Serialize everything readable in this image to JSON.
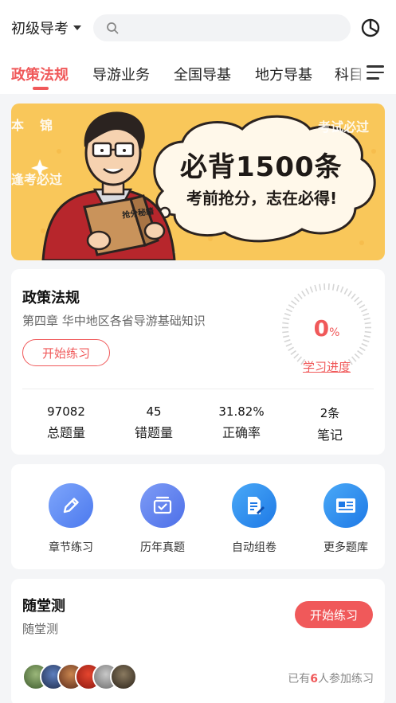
{
  "header": {
    "exam_selector": "初级导考",
    "search_placeholder": "",
    "stats_icon": "pie-chart-icon"
  },
  "tabs": [
    {
      "label": "政策法规",
      "active": true
    },
    {
      "label": "导游业务",
      "active": false
    },
    {
      "label": "全国导基",
      "active": false
    },
    {
      "label": "地方导基",
      "active": false
    },
    {
      "label": "科目",
      "active": false
    }
  ],
  "banner": {
    "headline": "必背1500条",
    "subline": "考前抢分，志在必得!",
    "book_label": "抢分秘籍",
    "bg_words": [
      "本",
      "锦",
      "逢考必过",
      "考试必过"
    ]
  },
  "policy_card": {
    "title": "政策法规",
    "chapter": "第四章  华中地区各省导游基础知识",
    "start_button": "开始练习",
    "progress": {
      "value": "0",
      "unit": "%",
      "fraction": 0,
      "link": "学习进度"
    },
    "stats": [
      {
        "value": "97082",
        "label": "总题量"
      },
      {
        "value": "45",
        "label": "错题量"
      },
      {
        "value": "31.82%",
        "label": "正确率"
      },
      {
        "value": "2条",
        "label": "笔记"
      }
    ]
  },
  "tools": [
    {
      "label": "章节练习",
      "icon": "pencil-icon",
      "color": "#5b8cf5"
    },
    {
      "label": "历年真题",
      "icon": "calendar-check-icon",
      "color": "#5a7ff0"
    },
    {
      "label": "自动组卷",
      "icon": "document-edit-icon",
      "color": "#2a8df0"
    },
    {
      "label": "更多题库",
      "icon": "newspaper-icon",
      "color": "#2a8df0"
    }
  ],
  "quiz_card": {
    "title": "随堂测",
    "subtitle": "随堂测",
    "start_button": "开始练习",
    "joined_prefix": "已有",
    "joined_count": "6",
    "joined_suffix": "人参加练习"
  },
  "colors": {
    "accent": "#f0595a",
    "banner_bg": "#f9c75a"
  }
}
